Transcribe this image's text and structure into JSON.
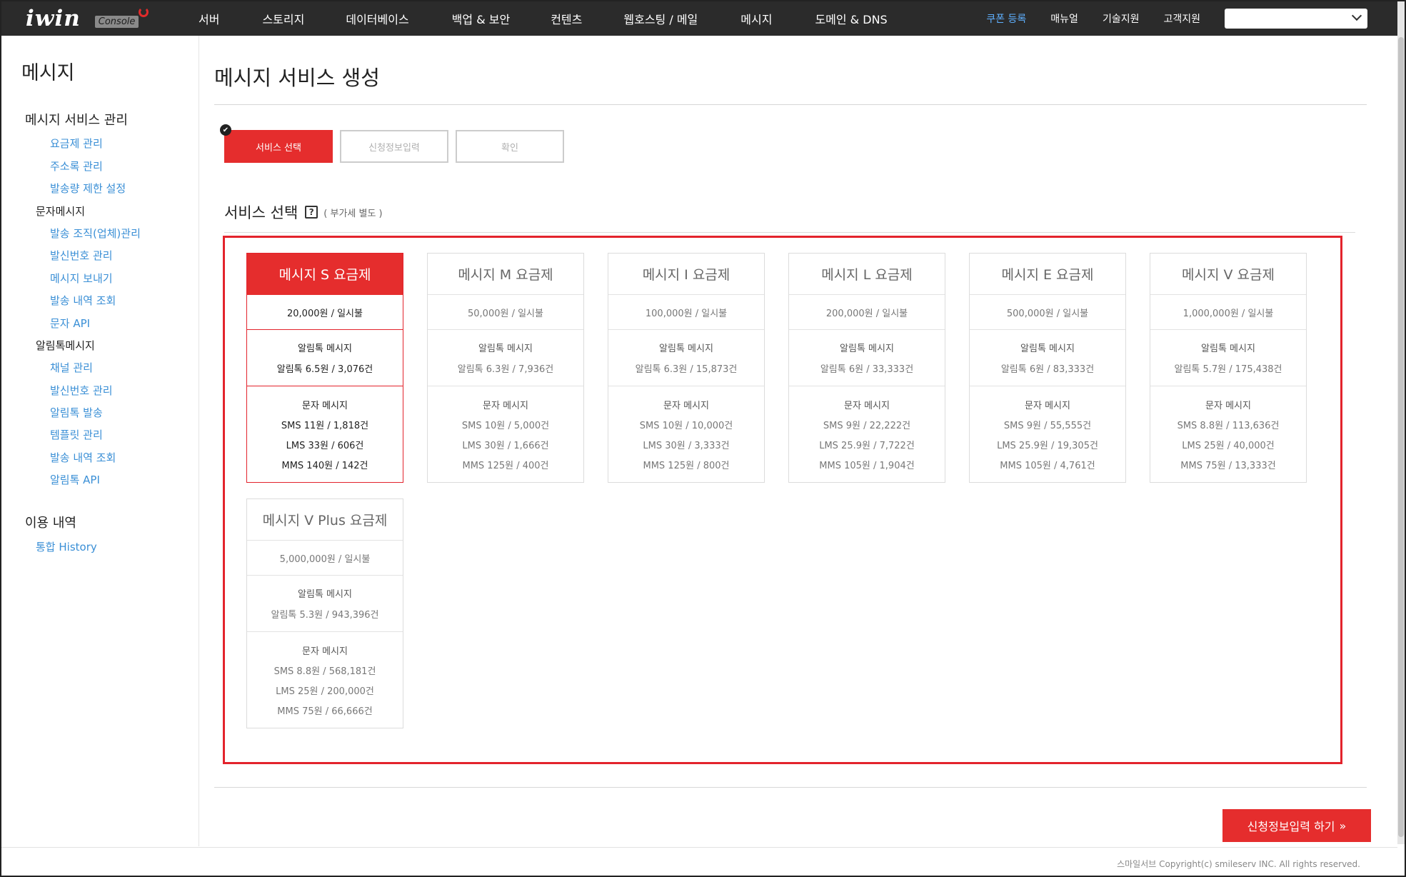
{
  "header": {
    "logo": "iwin",
    "logo_badge": "Console",
    "nav": [
      "서버",
      "스토리지",
      "데이터베이스",
      "백업 & 보안",
      "컨텐츠",
      "웹호스팅 / 메일",
      "메시지",
      "도메인 & DNS"
    ],
    "util": [
      "쿠폰 등록",
      "매뉴얼",
      "기술지원",
      "고객지원"
    ],
    "account_value": ""
  },
  "sidebar": {
    "title": "메시지",
    "section1": "메시지 서비스 관리",
    "section1_links": [
      "요금제 관리",
      "주소록 관리",
      "발송량 제한 설정"
    ],
    "sub1": "문자메시지",
    "sub1_links": [
      "발송 조직(업체)관리",
      "발신번호 관리",
      "메시지 보내기",
      "발송 내역 조회",
      "문자 API"
    ],
    "sub2": "알림톡메시지",
    "sub2_links": [
      "채널 관리",
      "발신번호 관리",
      "알림톡 발송",
      "템플릿 관리",
      "발송 내역 조회",
      "알림톡 API"
    ],
    "section2": "이용 내역",
    "section2_links": [
      "통합 History"
    ]
  },
  "main": {
    "page_title": "메시지 서비스 생성",
    "steps": [
      "서비스 선택",
      "신청정보입력",
      "확인"
    ],
    "step_check": "✔",
    "section_title": "서비스 선택",
    "help": "?",
    "vat_note": "( 부가세 별도 )",
    "alim_label": "알림톡 메시지",
    "sms_label": "문자 메시지",
    "plans": [
      {
        "name": "메시지 S 요금제",
        "price": "20,000원 / 일시불",
        "alim": "알림톡 6.5원 / 3,076건",
        "sms": "SMS 11원 / 1,818건",
        "lms": "LMS 33원 / 606건",
        "mms": "MMS 140원 / 142건"
      },
      {
        "name": "메시지 M 요금제",
        "price": "50,000원 / 일시불",
        "alim": "알림톡 6.3원 / 7,936건",
        "sms": "SMS 10원 / 5,000건",
        "lms": "LMS 30원 / 1,666건",
        "mms": "MMS 125원 / 400건"
      },
      {
        "name": "메시지 I 요금제",
        "price": "100,000원 / 일시불",
        "alim": "알림톡 6.3원 / 15,873건",
        "sms": "SMS 10원 / 10,000건",
        "lms": "LMS 30원 / 3,333건",
        "mms": "MMS 125원 / 800건"
      },
      {
        "name": "메시지 L 요금제",
        "price": "200,000원 / 일시불",
        "alim": "알림톡 6원 / 33,333건",
        "sms": "SMS 9원 / 22,222건",
        "lms": "LMS 25.9원 / 7,722건",
        "mms": "MMS 105원 / 1,904건"
      },
      {
        "name": "메시지 E 요금제",
        "price": "500,000원 / 일시불",
        "alim": "알림톡 6원 / 83,333건",
        "sms": "SMS 9원 / 55,555건",
        "lms": "LMS 25.9원 / 19,305건",
        "mms": "MMS 105원 / 4,761건"
      },
      {
        "name": "메시지 V 요금제",
        "price": "1,000,000원 / 일시불",
        "alim": "알림톡 5.7원 / 175,438건",
        "sms": "SMS 8.8원 / 113,636건",
        "lms": "LMS 25원 / 40,000건",
        "mms": "MMS 75원 / 13,333건"
      },
      {
        "name": "메시지 V Plus 요금제",
        "price": "5,000,000원 / 일시불",
        "alim": "알림톡 5.3원 / 943,396건",
        "sms": "SMS 8.8원 / 568,181건",
        "lms": "LMS 25원 / 200,000건",
        "mms": "MMS 75원 / 66,666건"
      }
    ],
    "selected_plan": 0,
    "next_button": "신청정보입력 하기",
    "next_icon": "»"
  },
  "footer": {
    "copyright": "스마일서브 Copyright(c) smileserv INC. All rights reserved."
  },
  "colors": {
    "accent": "#e52d2d",
    "nav_bg": "#2b2b2b",
    "link": "#3a8fd6",
    "coupon": "#5fb0ff"
  }
}
